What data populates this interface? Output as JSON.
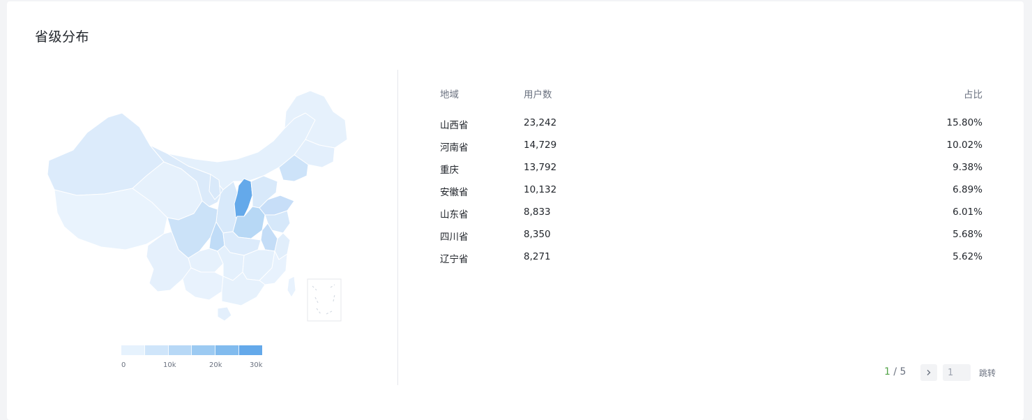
{
  "card": {
    "title": "省级分布"
  },
  "map": {
    "highlight_region": "山西省",
    "colors": {
      "min": "#e3f0fc",
      "low": "#d3e7fa",
      "mid": "#b7d8f5",
      "high": "#64a9ea",
      "stroke": "#ffffff"
    }
  },
  "legend": {
    "ticks": [
      "0",
      "10k",
      "20k",
      "30k"
    ],
    "colors": [
      "#e6f2fd",
      "#cfe5fa",
      "#b7d8f6",
      "#9ccaf2",
      "#81bbee",
      "#64a9ea"
    ]
  },
  "table": {
    "headers": {
      "region": "地域",
      "users": "用户数",
      "pct": "占比"
    },
    "rows": [
      {
        "region": "山西省",
        "users": "23,242",
        "pct": "15.80%"
      },
      {
        "region": "河南省",
        "users": "14,729",
        "pct": "10.02%"
      },
      {
        "region": "重庆",
        "users": "13,792",
        "pct": "9.38%"
      },
      {
        "region": "安徽省",
        "users": "10,132",
        "pct": "6.89%"
      },
      {
        "region": "山东省",
        "users": "8,833",
        "pct": "6.01%"
      },
      {
        "region": "四川省",
        "users": "8,350",
        "pct": "5.68%"
      },
      {
        "region": "辽宁省",
        "users": "8,271",
        "pct": "5.62%"
      }
    ]
  },
  "pager": {
    "current": "1",
    "separator": " / ",
    "total": "5",
    "next_icon": "chevron-right-icon",
    "input_value": "1",
    "jump_label": "跳转"
  }
}
